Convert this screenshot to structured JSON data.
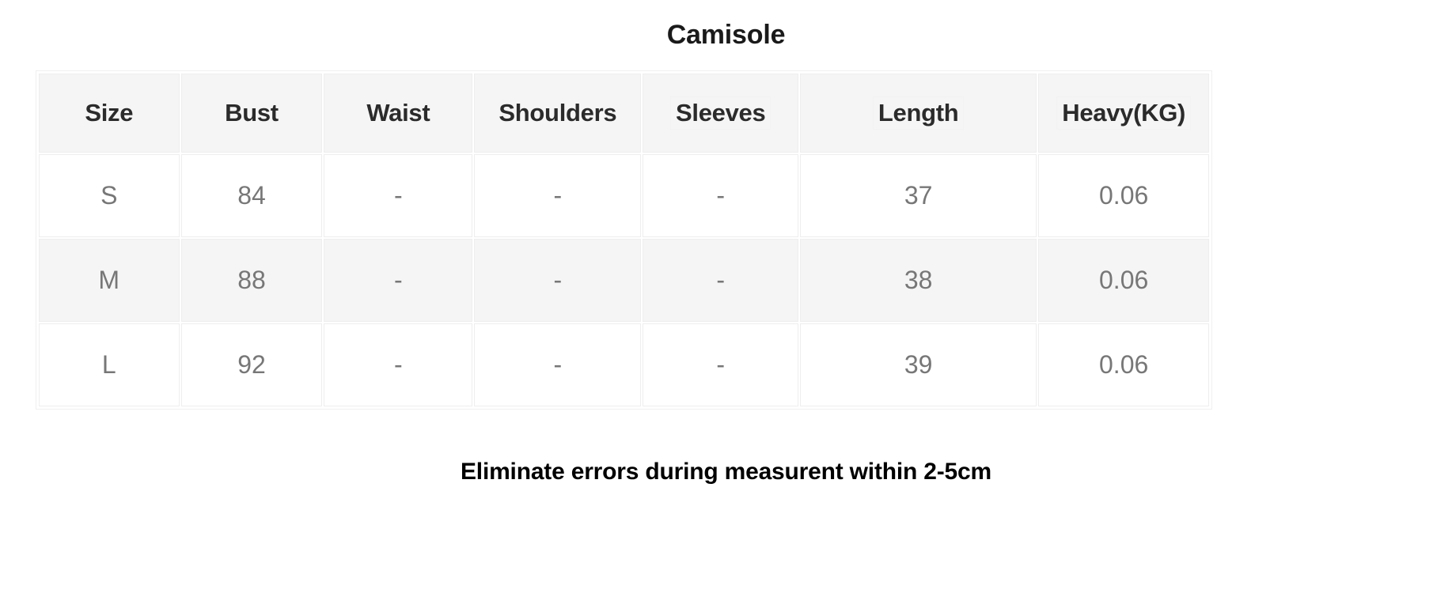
{
  "title": "Camisole",
  "table": {
    "columns": [
      "Size",
      "Bust",
      "Waist",
      "Shoulders",
      "Sleeves",
      "Length",
      "Heavy(KG)"
    ],
    "rows": [
      {
        "size": "S",
        "bust": "84",
        "waist": "-",
        "shoulders": "-",
        "sleeves": "-",
        "length": "37",
        "heavy": "0.06"
      },
      {
        "size": "M",
        "bust": "88",
        "waist": "-",
        "shoulders": "-",
        "sleeves": "-",
        "length": "38",
        "heavy": "0.06"
      },
      {
        "size": "L",
        "bust": "92",
        "waist": "-",
        "shoulders": "-",
        "sleeves": "-",
        "length": "39",
        "heavy": "0.06"
      }
    ]
  },
  "footer_note": "Eliminate errors during measurent within 2-5cm",
  "colors": {
    "header_background": "#f5f5f5",
    "alt_row_background": "#f5f5f5",
    "border": "#eeeeee",
    "cell_text": "#777777",
    "header_text": "#2b2b2b",
    "title_text": "#1a1a1a",
    "footer_text": "#000000"
  }
}
